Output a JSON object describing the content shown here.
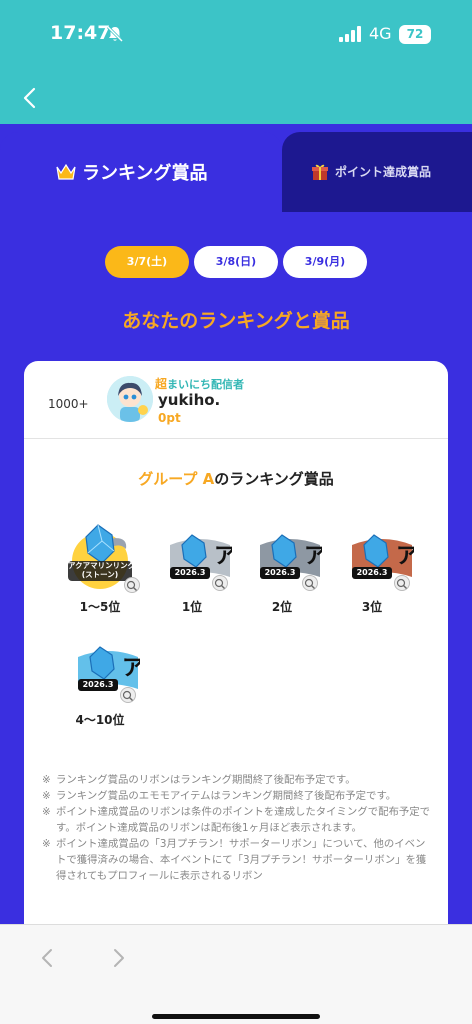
{
  "status": {
    "time": "17:47",
    "network": "4G",
    "battery": "72"
  },
  "tabs": {
    "ranking": "ランキング賞品",
    "point": "ポイント達成賞品"
  },
  "dates": [
    "3/7(土)",
    "3/8(日)",
    "3/9(月)"
  ],
  "section_title": "あなたのランキングと賞品",
  "user": {
    "rank": "1000+",
    "badge_prefix": "超",
    "badge": "まいにち配信者",
    "name": "yukiho.",
    "points": "0pt"
  },
  "group": {
    "accent": "グループ A",
    "rest": "のランキング賞品"
  },
  "prizes": {
    "p1": {
      "label": "1〜5位",
      "item_text": "アクアマリンリング\n(ストーン)"
    },
    "p2": {
      "label": "1位",
      "year": "2026.3"
    },
    "p3": {
      "label": "2位",
      "year": "2026.3"
    },
    "p4": {
      "label": "3位",
      "year": "2026.3"
    },
    "p5": {
      "label": "4〜10位",
      "year": "2026.3"
    }
  },
  "notes": [
    "ランキング賞品のリボンはランキング期間終了後配布予定です。",
    "ランキング賞品のエモモアイテムはランキング期間終了後配布予定です。",
    "ポイント達成賞品のリボンは条件のポイントを達成したタイミングで配布予定です。ポイント達成賞品のリボンは配布後1ヶ月ほど表示されます。",
    "ポイント達成賞品の「3月プチラン！サポーターリボン」について、他のイベントで獲得済みの場合、本イベントにて「3月プチラン！サポーターリボン」を獲得されてもプロフィールに表示されるリボン"
  ],
  "note_mark": "※",
  "colors": {
    "teal": "#3cc4c7",
    "blue": "#3a2fe0",
    "dark_tab": "#1d1890",
    "orange": "#f7a823",
    "yellow": "#fbb818"
  }
}
